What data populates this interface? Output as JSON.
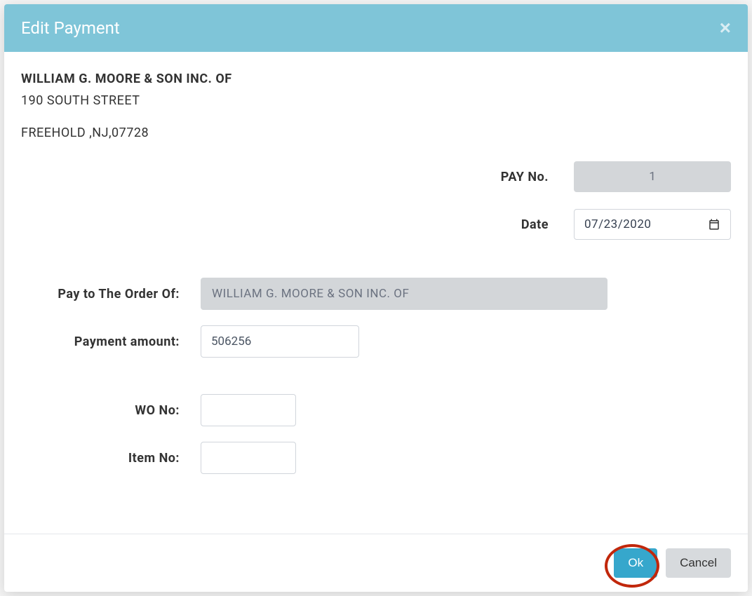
{
  "modal": {
    "title": "Edit Payment",
    "close": "×"
  },
  "company": {
    "name": "WILLIAM G. MOORE & SON INC. OF",
    "street": "190 SOUTH STREET",
    "city_state_zip": "FREEHOLD ,NJ,07728"
  },
  "fields": {
    "pay_no_label": "PAY No.",
    "pay_no_value": "1",
    "date_label": "Date",
    "date_value": "07/23/2020",
    "pay_to_label": "Pay to The Order Of:",
    "pay_to_value": "WILLIAM G. MOORE & SON INC. OF",
    "amount_label": "Payment amount:",
    "amount_value": "506256",
    "wo_no_label": "WO No:",
    "wo_no_value": "",
    "item_no_label": "Item No:",
    "item_no_value": ""
  },
  "footer": {
    "ok": "Ok",
    "cancel": "Cancel"
  }
}
